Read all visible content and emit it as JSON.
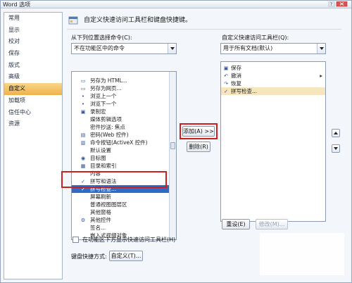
{
  "window": {
    "title": "Word 选项"
  },
  "sidebar": {
    "items": [
      {
        "label": "常用",
        "active": false
      },
      {
        "label": "显示",
        "active": false
      },
      {
        "label": "校对",
        "active": false
      },
      {
        "label": "保存",
        "active": false
      },
      {
        "label": "版式",
        "active": false
      },
      {
        "label": "高级",
        "active": false
      },
      {
        "label": "自定义",
        "active": true
      },
      {
        "label": "加载项",
        "active": false
      },
      {
        "label": "信任中心",
        "active": false
      },
      {
        "label": "资源",
        "active": false
      }
    ]
  },
  "header": {
    "text": "自定义快速访问工具栏和键盘快捷键。"
  },
  "left_panel": {
    "label": "从下列位置选择命令(C):",
    "combo_value": "不在功能区中的命令",
    "items": [
      {
        "label": "另存为 HTML...",
        "icon": "document-icon"
      },
      {
        "label": "另存为网页...",
        "icon": "document-icon"
      },
      {
        "label": "浏览上一个",
        "icon": "dot-icon"
      },
      {
        "label": "浏览下一个",
        "icon": "dot-icon"
      },
      {
        "label": "录制宏",
        "icon": "record-icon"
      },
      {
        "label": "媒体剪辑选项",
        "icon": ""
      },
      {
        "label": "密件抄送: 焦点",
        "icon": ""
      },
      {
        "label": "密码(Web 控件)",
        "icon": "password-icon"
      },
      {
        "label": "命令按钮(ActiveX 控件)",
        "icon": "button-icon"
      },
      {
        "label": "默认设置",
        "icon": ""
      },
      {
        "label": "目标图",
        "icon": "target-icon"
      },
      {
        "label": "目录和索引",
        "icon": "index-icon"
      },
      {
        "label": "内容",
        "icon": ""
      },
      {
        "label": "拼写和语法",
        "icon": "spell-icon"
      },
      {
        "label": "拼写检查...",
        "icon": "spellcheck-icon"
      },
      {
        "label": "屏幕刷新",
        "icon": ""
      },
      {
        "label": "普通视图图层区",
        "icon": ""
      },
      {
        "label": "其他窗格",
        "icon": ""
      },
      {
        "label": "其他控件",
        "icon": "control-icon"
      },
      {
        "label": "签名...",
        "icon": ""
      },
      {
        "label": "嵌入式视频对象",
        "icon": ""
      }
    ],
    "selected_index": 14
  },
  "buttons": {
    "add": "添加(A) >>",
    "remove": "删除(R)",
    "reset": "重设(E)",
    "modify": "修改(M)...",
    "keyboard_customize": "自定义(T)..."
  },
  "right_panel": {
    "label": "自定义快速访问工具栏(Q):",
    "combo_value": "用于所有文档(默认)",
    "items": [
      {
        "label": "保存",
        "icon": "save-icon"
      },
      {
        "label": "撤消",
        "icon": "undo-icon"
      },
      {
        "label": "恢复",
        "icon": "redo-icon"
      },
      {
        "label": "拼写检查...",
        "icon": "spellcheck-icon"
      }
    ],
    "selected_index": 3
  },
  "bottom": {
    "checkbox_label": "在功能区下方显示快速访问工具栏(H)",
    "keyboard_label": "键盘快捷方式:"
  },
  "colors": {
    "accent": "#f0b24a",
    "highlight": "#cc1f1f",
    "selection": "#316ac5"
  }
}
